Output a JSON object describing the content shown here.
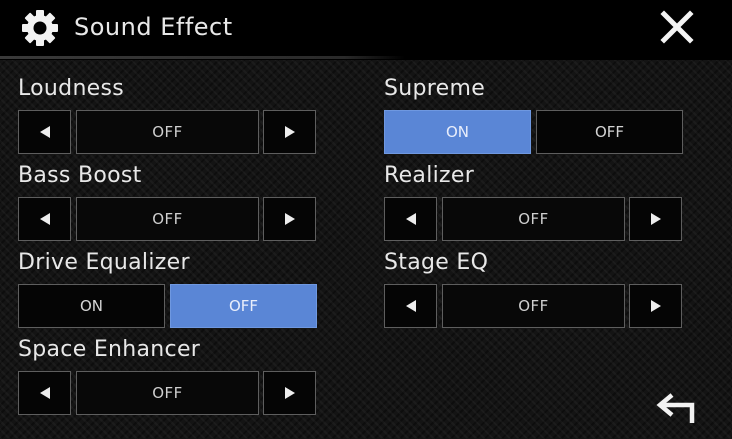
{
  "header": {
    "title": "Sound Effect"
  },
  "icons": {
    "settings": "gear-icon",
    "close": "close-icon",
    "back": "back-arrow-icon",
    "left": "left-triangle-icon",
    "right": "right-triangle-icon"
  },
  "colors": {
    "active_toggle": "#5a86d6",
    "header_bg": "#000000",
    "background": "#141414"
  },
  "loudness": {
    "label": "Loudness",
    "value": "OFF"
  },
  "bass_boost": {
    "label": "Bass Boost",
    "value": "OFF"
  },
  "drive_equalizer": {
    "label": "Drive Equalizer",
    "on": "ON",
    "off": "OFF",
    "selected": "OFF"
  },
  "space_enhancer": {
    "label": "Space Enhancer",
    "value": "OFF"
  },
  "supreme": {
    "label": "Supreme",
    "on": "ON",
    "off": "OFF",
    "selected": "ON"
  },
  "realizer": {
    "label": "Realizer",
    "value": "OFF"
  },
  "stage_eq": {
    "label": "Stage EQ",
    "value": "OFF"
  }
}
